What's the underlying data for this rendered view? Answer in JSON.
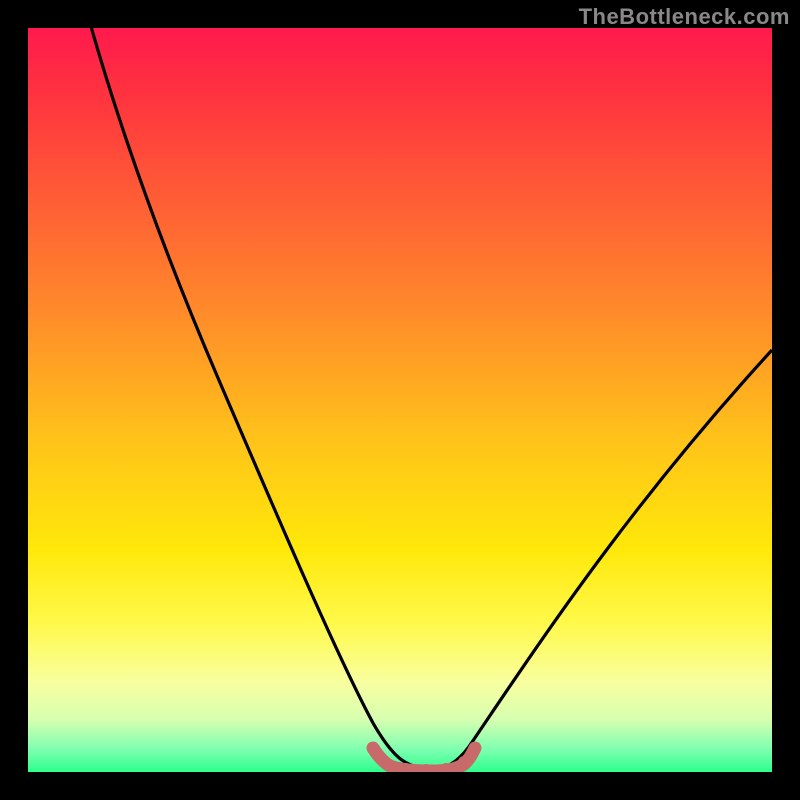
{
  "watermark": "TheBottleneck.com",
  "chart_data": {
    "type": "line",
    "title": "",
    "xlabel": "",
    "ylabel": "",
    "ylim": [
      0,
      100
    ],
    "xlim": [
      0,
      100
    ],
    "series": [
      {
        "name": "bottleneck-curve",
        "x": [
          0,
          10,
          20,
          30,
          40,
          45,
          48,
          52,
          55,
          58,
          62,
          70,
          80,
          90,
          100
        ],
        "values": [
          105,
          86,
          67,
          48,
          29,
          18,
          6,
          0,
          0,
          2,
          10,
          22,
          35,
          47,
          58
        ]
      },
      {
        "name": "optimal-band",
        "x": [
          47,
          49,
          51,
          53,
          55,
          57,
          59
        ],
        "values": [
          3,
          1,
          0,
          0,
          0,
          1,
          3
        ]
      }
    ],
    "gradient_colors": {
      "top": "#ff1a4d",
      "upper_mid": "#ff8a2a",
      "mid": "#ffe80a",
      "lower_mid": "#d6ffb0",
      "bottom": "#2dff8c"
    },
    "optimal_marker_color": "#c96a6a"
  }
}
